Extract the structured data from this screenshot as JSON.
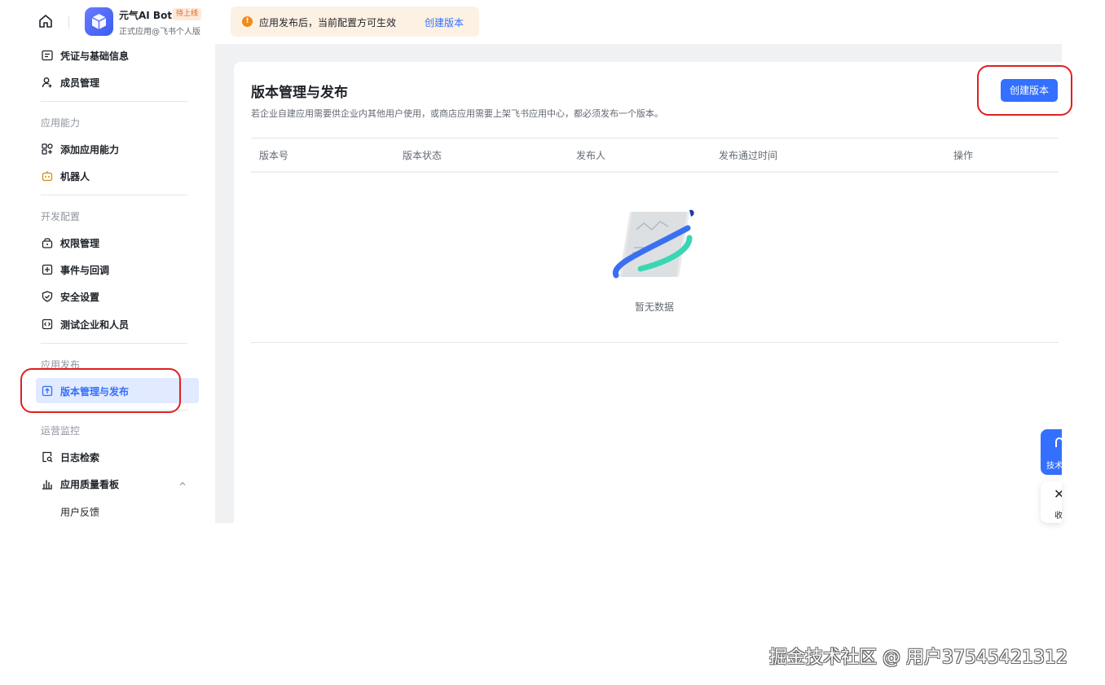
{
  "header": {
    "app_name": "元气AI Bot",
    "app_badge": "待上线",
    "app_subtitle": "正式应用@飞书个人版",
    "notice_text": "应用发布后，当前配置方可生效",
    "notice_link": "创建版本"
  },
  "sidebar": {
    "items_top": [
      {
        "label": "凭证与基础信息",
        "icon": "credential-icon"
      },
      {
        "label": "成员管理",
        "icon": "member-icon"
      }
    ],
    "sections": [
      {
        "title": "应用能力",
        "items": [
          {
            "label": "添加应用能力",
            "icon": "apps-icon"
          },
          {
            "label": "机器人",
            "icon": "robot-icon"
          }
        ]
      },
      {
        "title": "开发配置",
        "items": [
          {
            "label": "权限管理",
            "icon": "lock-icon"
          },
          {
            "label": "事件与回调",
            "icon": "event-icon"
          },
          {
            "label": "安全设置",
            "icon": "shield-icon"
          },
          {
            "label": "测试企业和人员",
            "icon": "code-icon"
          }
        ]
      },
      {
        "title": "应用发布",
        "items": [
          {
            "label": "版本管理与发布",
            "icon": "upload-icon",
            "active": true
          }
        ]
      },
      {
        "title": "运营监控",
        "items": [
          {
            "label": "日志检索",
            "icon": "log-search-icon"
          },
          {
            "label": "应用质量看板",
            "icon": "chart-icon"
          },
          {
            "label": "用户反馈",
            "icon": ""
          }
        ]
      }
    ]
  },
  "main": {
    "title": "版本管理与发布",
    "description": "若企业自建应用需要供企业内其他用户使用，或商店应用需要上架飞书应用中心，都必须发布一个版本。",
    "create_button": "创建版本",
    "columns": [
      "版本号",
      "版本状态",
      "发布人",
      "发布通过时间",
      "操作"
    ],
    "empty_text": "暂无数据"
  },
  "floating": {
    "help_label": "技术支持",
    "close_label": "收起"
  },
  "watermark": "掘金技术社区 @ 用户37545421312",
  "colors": {
    "accent": "#3370ff",
    "annotation": "#e02020",
    "notice_bg": "#fdf1e3",
    "active_bg": "#e1eaff"
  }
}
